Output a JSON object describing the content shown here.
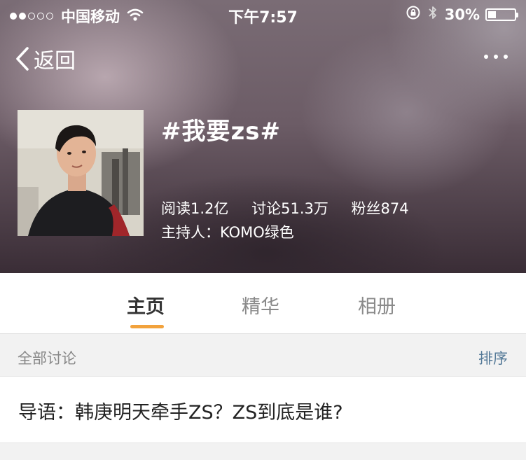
{
  "status_bar": {
    "carrier": "中国移动",
    "time": "下午7:57",
    "battery_text": "30%",
    "battery_level": 0.3,
    "signal_dots_filled": 2,
    "signal_dots_total": 5
  },
  "nav": {
    "back_label": "返回",
    "more_icon": "more-dots-icon"
  },
  "topic": {
    "title": "#我要zs#",
    "stats": {
      "reads": "阅读1.2亿",
      "discussions": "讨论51.3万",
      "fans": "粉丝874"
    },
    "host": "主持人：KOMO绿色"
  },
  "tabs": [
    {
      "label": "主页",
      "active": true
    },
    {
      "label": "精华",
      "active": false
    },
    {
      "label": "相册",
      "active": false
    }
  ],
  "section": {
    "title": "全部讨论",
    "sort_label": "排序"
  },
  "post": {
    "text": "导语：韩庚明天牵手ZS？ZS到底是谁?"
  },
  "colors": {
    "tab_indicator": "#f2a23c",
    "sort_link": "#557a98"
  }
}
